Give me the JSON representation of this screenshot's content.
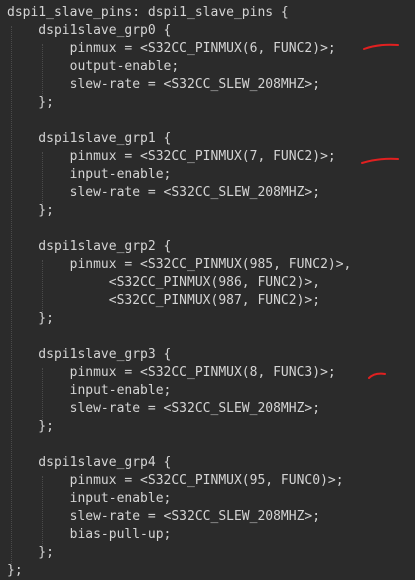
{
  "editor": {
    "background": "#2b2b2b",
    "text_color": "#d4d4d4",
    "mark_color": "#e02020",
    "lines": [
      "dspi1_slave_pins: dspi1_slave_pins {",
      "    dspi1slave_grp0 {",
      "        pinmux = <S32CC_PINMUX(6, FUNC2)>;",
      "        output-enable;",
      "        slew-rate = <S32CC_SLEW_208MHZ>;",
      "    };",
      "",
      "    dspi1slave_grp1 {",
      "        pinmux = <S32CC_PINMUX(7, FUNC2)>;",
      "        input-enable;",
      "        slew-rate = <S32CC_SLEW_208MHZ>;",
      "    };",
      "",
      "    dspi1slave_grp2 {",
      "        pinmux = <S32CC_PINMUX(985, FUNC2)>,",
      "             <S32CC_PINMUX(986, FUNC2)>,",
      "             <S32CC_PINMUX(987, FUNC2)>;",
      "    };",
      "",
      "    dspi1slave_grp3 {",
      "        pinmux = <S32CC_PINMUX(8, FUNC3)>;",
      "        input-enable;",
      "        slew-rate = <S32CC_SLEW_208MHZ>;",
      "    };",
      "",
      "    dspi1slave_grp4 {",
      "        pinmux = <S32CC_PINMUX(95, FUNC0)>;",
      "        input-enable;",
      "        slew-rate = <S32CC_SLEW_208MHZ>;",
      "        bias-pull-up;",
      "    };",
      "};"
    ],
    "annotation_marks": [
      {
        "after_line": 2,
        "shape": "underline-stroke"
      },
      {
        "after_line": 8,
        "shape": "underline-stroke"
      },
      {
        "after_line": 20,
        "shape": "underline-stroke"
      }
    ]
  }
}
